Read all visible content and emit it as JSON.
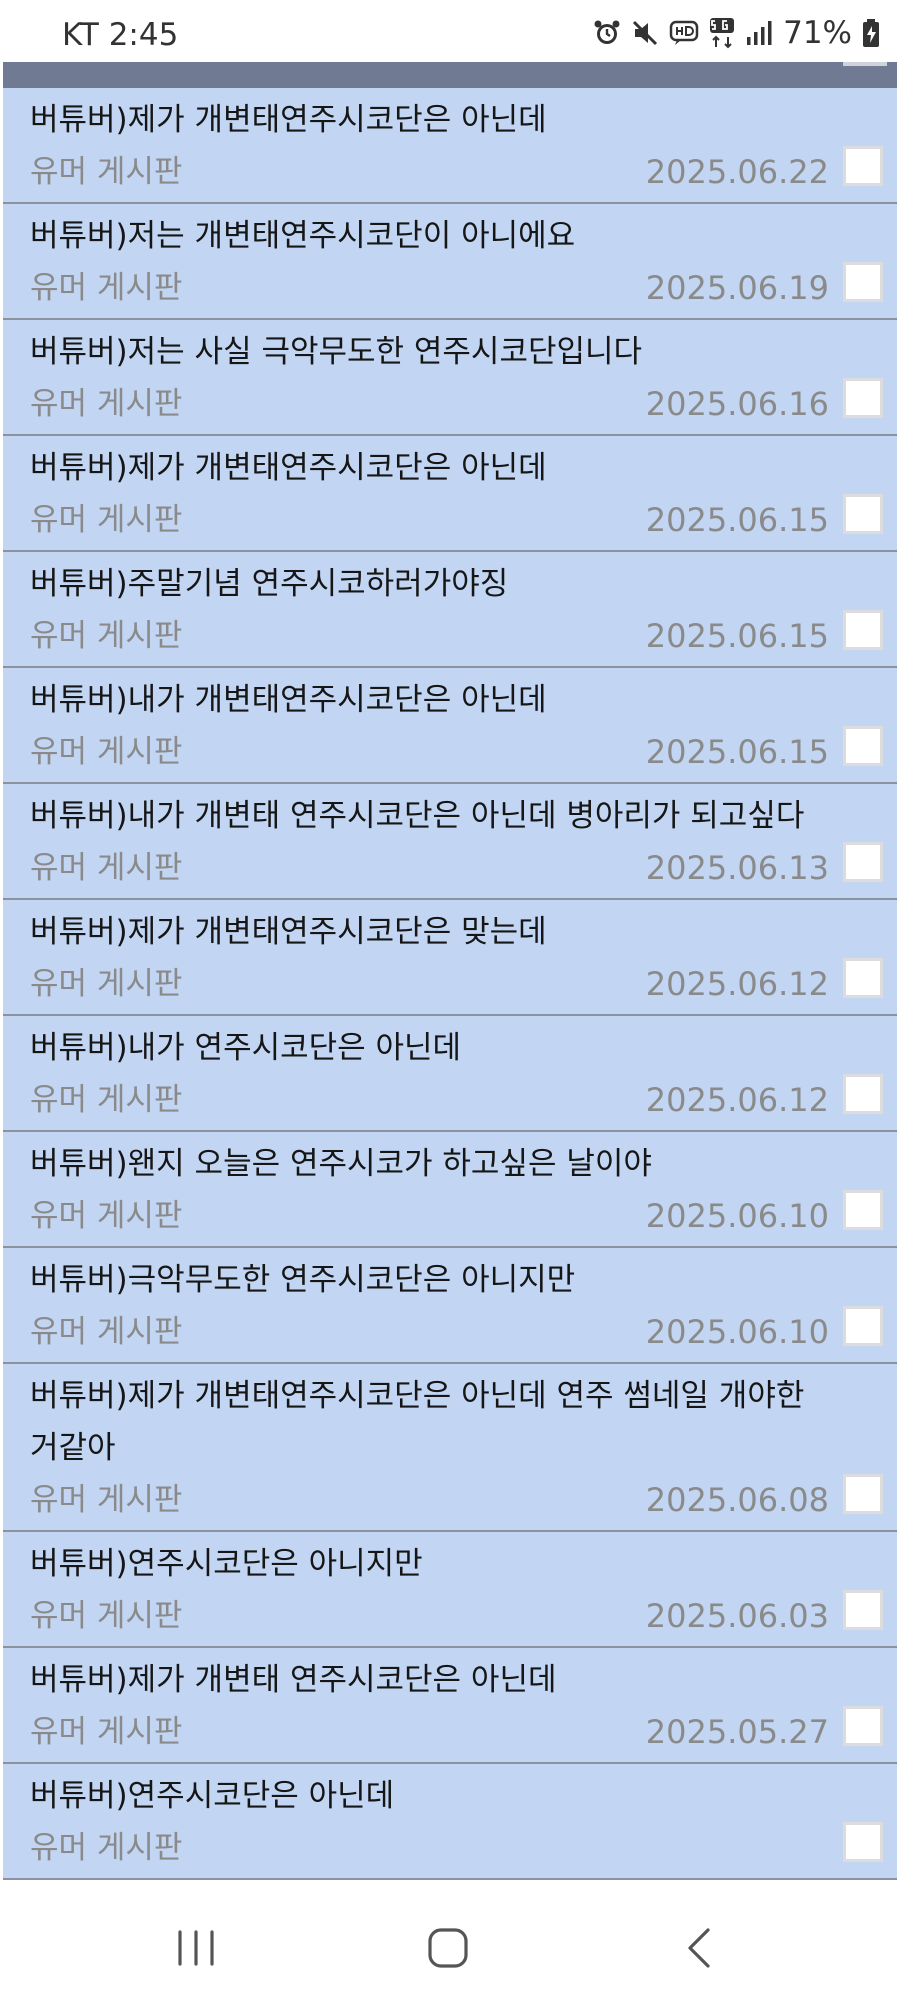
{
  "status_bar": {
    "carrier_time": "KT 2:45",
    "battery": "71%",
    "icons": [
      "alarm-icon",
      "mute-icon",
      "hd-icon",
      "5g-icon",
      "signal-icon",
      "battery-icon"
    ]
  },
  "colors": {
    "row_bg": "#c2d6f3",
    "header_strip": "#707b93",
    "muted_text": "#8a8a8a"
  },
  "posts": [
    {
      "title": "버튜버)제가 개변태연주시코단은 아닌데",
      "board": "유머 게시판",
      "date": "2025.06.22"
    },
    {
      "title": "버튜버)저는 개변태연주시코단이 아니에요",
      "board": "유머 게시판",
      "date": "2025.06.19"
    },
    {
      "title": "버튜버)저는 사실 극악무도한 연주시코단입니다",
      "board": "유머 게시판",
      "date": "2025.06.16"
    },
    {
      "title": "버튜버)제가 개변태연주시코단은 아닌데",
      "board": "유머 게시판",
      "date": "2025.06.15"
    },
    {
      "title": "버튜버)주말기념 연주시코하러가야징",
      "board": "유머 게시판",
      "date": "2025.06.15"
    },
    {
      "title": "버튜버)내가 개변태연주시코단은 아닌데",
      "board": "유머 게시판",
      "date": "2025.06.15"
    },
    {
      "title": "버튜버)내가 개변태 연주시코단은 아닌데 병아리가 되고싶다",
      "board": "유머 게시판",
      "date": "2025.06.13"
    },
    {
      "title": "버튜버)제가 개변태연주시코단은 맞는데",
      "board": "유머 게시판",
      "date": "2025.06.12"
    },
    {
      "title": "버튜버)내가 연주시코단은 아닌데",
      "board": "유머 게시판",
      "date": "2025.06.12"
    },
    {
      "title": "버튜버)왠지 오늘은 연주시코가 하고싶은 날이야",
      "board": "유머 게시판",
      "date": "2025.06.10"
    },
    {
      "title": "버튜버)극악무도한 연주시코단은 아니지만",
      "board": "유머 게시판",
      "date": "2025.06.10"
    },
    {
      "title": "버튜버)제가 개변태연주시코단은 아닌데 연주 썸네일 개야한 거같아",
      "board": "유머 게시판",
      "date": "2025.06.08"
    },
    {
      "title": "버튜버)연주시코단은 아니지만",
      "board": "유머 게시판",
      "date": "2025.06.03"
    },
    {
      "title": "버튜버)제가 개변태 연주시코단은 아닌데",
      "board": "유머 게시판",
      "date": "2025.05.27"
    },
    {
      "title": "버튜버)연주시코단은 아닌데",
      "board": "유머 게시판",
      "date": ""
    }
  ]
}
